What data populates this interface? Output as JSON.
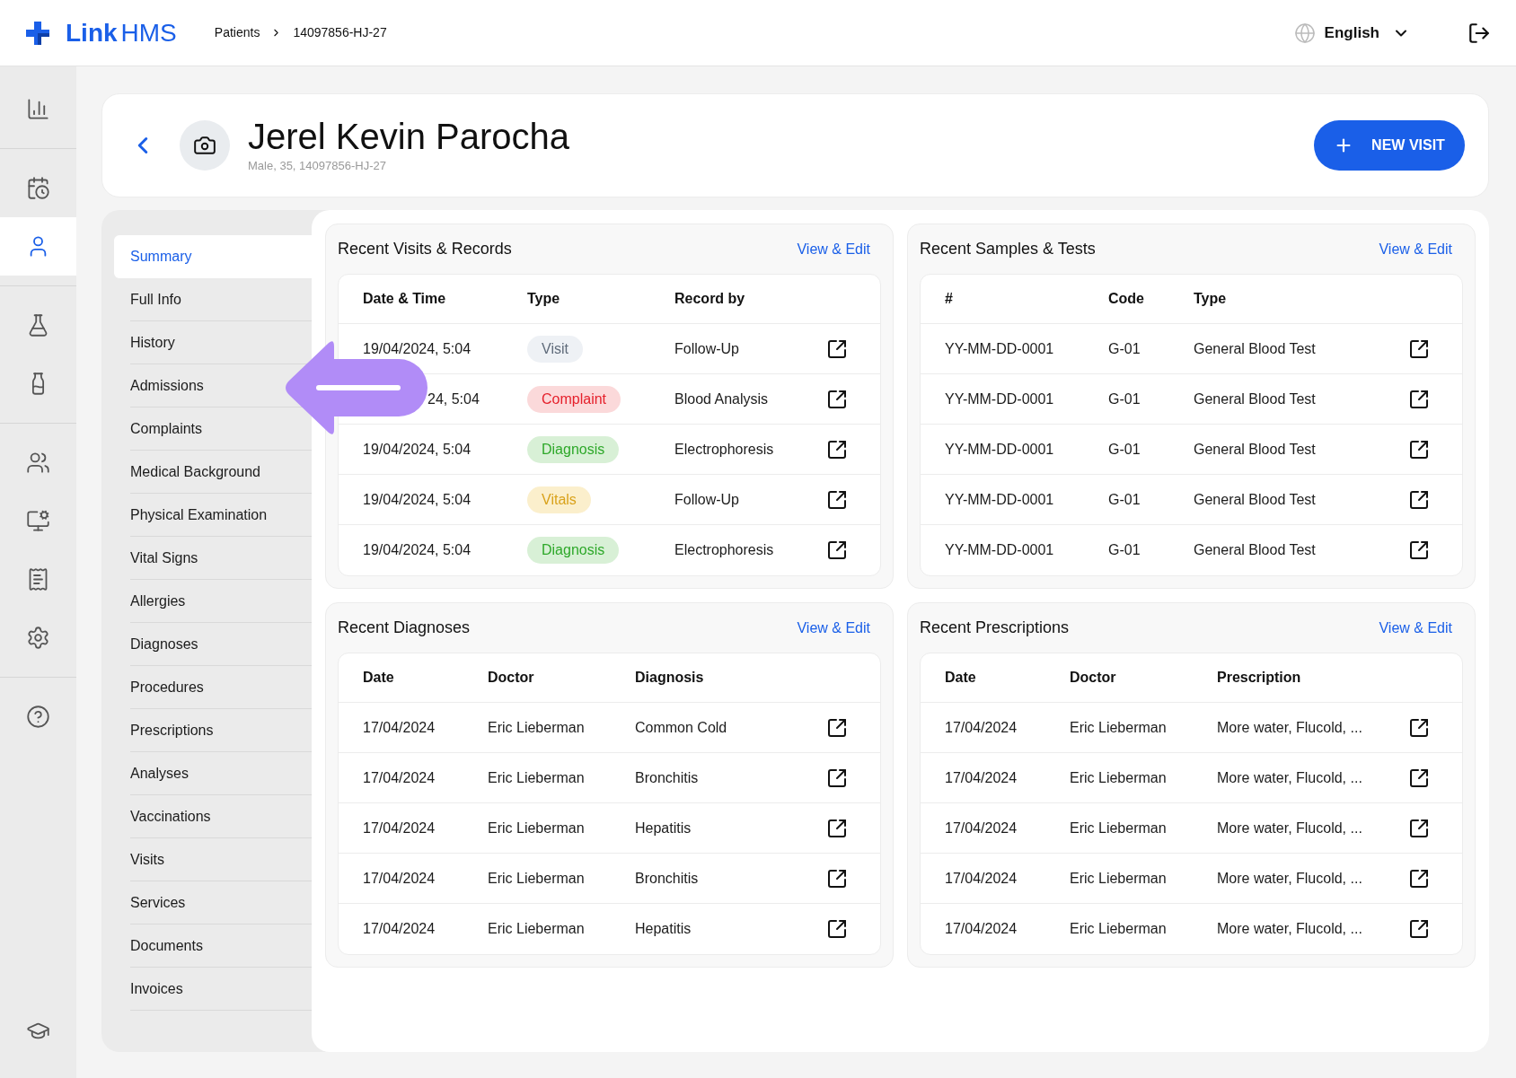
{
  "header": {
    "logo_first": "Link",
    "logo_second": "HMS",
    "breadcrumb": [
      "Patients",
      "14097856-HJ-27"
    ],
    "language": "English"
  },
  "rail": [
    {
      "kind": "chart",
      "selected": false,
      "divider": true
    },
    {
      "kind": "calendar",
      "selected": false,
      "divider": false
    },
    {
      "kind": "user",
      "selected": true,
      "divider": true
    },
    {
      "kind": "flask",
      "selected": false,
      "divider": false
    },
    {
      "kind": "bottle",
      "selected": false,
      "divider": true
    },
    {
      "kind": "users",
      "selected": false,
      "divider": false
    },
    {
      "kind": "monitor",
      "selected": false,
      "divider": false
    },
    {
      "kind": "invoice",
      "selected": false,
      "divider": false
    },
    {
      "kind": "settings",
      "selected": false,
      "divider": true
    },
    {
      "kind": "help",
      "selected": false,
      "divider": false
    }
  ],
  "rail_bottom": {
    "kind": "learn",
    "selected": false
  },
  "patient": {
    "name": "Jerel Kevin Parocha",
    "details": "Male, 35, 14097856-HJ-27",
    "button": "NEW VISIT"
  },
  "subnav": [
    {
      "label": "Summary",
      "selected": true
    },
    {
      "label": "Full Info",
      "selected": false
    },
    {
      "label": "History",
      "selected": false
    },
    {
      "label": "Admissions",
      "selected": false
    },
    {
      "label": "Complaints",
      "selected": false
    },
    {
      "label": "Medical Background",
      "selected": false
    },
    {
      "label": "Physical Examination",
      "selected": false
    },
    {
      "label": "Vital Signs",
      "selected": false
    },
    {
      "label": "Allergies",
      "selected": false
    },
    {
      "label": "Diagnoses",
      "selected": false
    },
    {
      "label": "Procedures",
      "selected": false
    },
    {
      "label": "Prescriptions",
      "selected": false
    },
    {
      "label": "Analyses",
      "selected": false
    },
    {
      "label": "Vaccinations",
      "selected": false
    },
    {
      "label": "Visits",
      "selected": false
    },
    {
      "label": "Services",
      "selected": false
    },
    {
      "label": "Documents",
      "selected": false
    },
    {
      "label": "Invoices",
      "selected": false
    }
  ],
  "panels": [
    {
      "title": "Recent Visits & Records",
      "action": "View & Edit",
      "columns": [
        "Date & Time",
        "Type",
        "Record by"
      ],
      "rows": [
        {
          "cells": [
            "19/04/2024, 5:04",
            {
              "tag": "Visit",
              "kind": "visit"
            },
            "Follow-Up"
          ]
        },
        {
          "cells": [
            "24, 5:04",
            {
              "tag": "Complaint",
              "kind": "complaint"
            },
            "Blood Analysis"
          ],
          "covered": true
        },
        {
          "cells": [
            "19/04/2024, 5:04",
            {
              "tag": "Diagnosis",
              "kind": "diagnosis"
            },
            "Electrophoresis"
          ]
        },
        {
          "cells": [
            "19/04/2024, 5:04",
            {
              "tag": "Vitals",
              "kind": "vitals"
            },
            "Follow-Up"
          ]
        },
        {
          "cells": [
            "19/04/2024, 5:04",
            {
              "tag": "Diagnosis",
              "kind": "diagnosis"
            },
            "Electrophoresis"
          ]
        }
      ]
    },
    {
      "title": "Recent Samples & Tests",
      "action": "View & Edit",
      "columns": [
        "#",
        "Code",
        "Type"
      ],
      "rows": [
        {
          "cells": [
            "YY-MM-DD-0001",
            "G-01",
            "General Blood Test"
          ]
        },
        {
          "cells": [
            "YY-MM-DD-0001",
            "G-01",
            "General Blood Test"
          ]
        },
        {
          "cells": [
            "YY-MM-DD-0001",
            "G-01",
            "General Blood Test"
          ]
        },
        {
          "cells": [
            "YY-MM-DD-0001",
            "G-01",
            "General Blood Test"
          ]
        },
        {
          "cells": [
            "YY-MM-DD-0001",
            "G-01",
            "General Blood Test"
          ]
        }
      ]
    },
    {
      "title": "Recent Diagnoses",
      "action": "View & Edit",
      "columns": [
        "Date",
        "Doctor",
        "Diagnosis"
      ],
      "rows": [
        {
          "cells": [
            "17/04/2024",
            "Eric Lieberman",
            "Common Cold"
          ]
        },
        {
          "cells": [
            "17/04/2024",
            "Eric Lieberman",
            "Bronchitis"
          ]
        },
        {
          "cells": [
            "17/04/2024",
            "Eric Lieberman",
            "Hepatitis"
          ]
        },
        {
          "cells": [
            "17/04/2024",
            "Eric Lieberman",
            "Bronchitis"
          ]
        },
        {
          "cells": [
            "17/04/2024",
            "Eric Lieberman",
            "Hepatitis"
          ]
        }
      ]
    },
    {
      "title": "Recent Prescriptions",
      "action": "View & Edit",
      "columns": [
        "Date",
        "Doctor",
        "Prescription"
      ],
      "rows": [
        {
          "cells": [
            "17/04/2024",
            "Eric Lieberman",
            "More water, Flucold, ..."
          ]
        },
        {
          "cells": [
            "17/04/2024",
            "Eric Lieberman",
            "More water, Flucold, ..."
          ]
        },
        {
          "cells": [
            "17/04/2024",
            "Eric Lieberman",
            "More water, Flucold, ..."
          ]
        },
        {
          "cells": [
            "17/04/2024",
            "Eric Lieberman",
            "More water, Flucold, ..."
          ]
        },
        {
          "cells": [
            "17/04/2024",
            "Eric Lieberman",
            "More water, Flucold, ..."
          ]
        }
      ]
    }
  ]
}
